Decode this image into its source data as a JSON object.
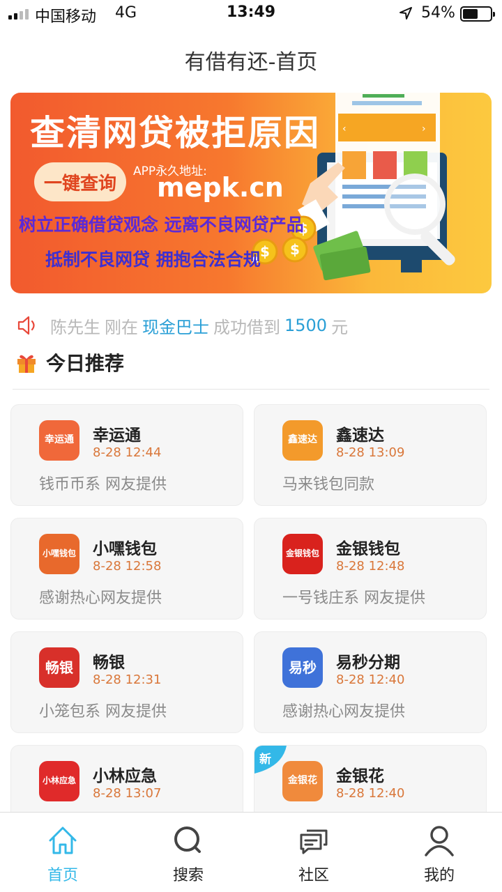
{
  "status_bar": {
    "carrier": "中国移动",
    "network": "4G",
    "time": "13:49",
    "battery_percent": "54%",
    "battery_level": 0.54
  },
  "header": {
    "title": "有借有还-首页"
  },
  "banner": {
    "headline": "查清网贷被拒原因",
    "button_label": "一键查询",
    "address_label": "APP永久地址:",
    "url": "mepk.cn",
    "line1": "树立正确借贷观念 远离不良网贷产品",
    "line2": "抵制不良网贷 拥抱合法合规"
  },
  "notice": {
    "name": "陈先生",
    "just": "刚在",
    "platform": "现金巴士",
    "success": "成功借到",
    "amount": "1500",
    "unit": "元"
  },
  "section": {
    "title": "今日推荐"
  },
  "cards": [
    {
      "name": "幸运通",
      "date": "8-28 12:44",
      "desc": "钱币币系 网友提供",
      "logo_text": "幸运通",
      "logo_color": "#f0683a",
      "is_new": false
    },
    {
      "name": "鑫速达",
      "date": "8-28 13:09",
      "desc": "马来钱包同款",
      "logo_text": "鑫速达",
      "logo_color": "#f39a2b",
      "is_new": false
    },
    {
      "name": "小嘿钱包",
      "date": "8-28 12:58",
      "desc": "感谢热心网友提供",
      "logo_text": "小嘿钱包",
      "logo_color": "#e8692c",
      "is_new": false
    },
    {
      "name": "金银钱包",
      "date": "8-28 12:48",
      "desc": "一号钱庄系 网友提供",
      "logo_text": "金银钱包",
      "logo_color": "#d9221d",
      "is_new": false
    },
    {
      "name": "畅银",
      "date": "8-28 12:31",
      "desc": "小笼包系 网友提供",
      "logo_text": "畅银",
      "logo_color": "#d8302a",
      "is_new": false
    },
    {
      "name": "易秒分期",
      "date": "8-28 12:40",
      "desc": "感谢热心网友提供",
      "logo_text": "易秒",
      "logo_sub": "易秒分期",
      "logo_color": "#3f72d9",
      "is_new": false
    },
    {
      "name": "小林应急",
      "date": "8-28 13:07",
      "desc": "",
      "logo_text": "小林应急",
      "logo_color": "#e02a2a",
      "is_new": false
    },
    {
      "name": "金银花",
      "date": "8-28 12:40",
      "desc": "",
      "logo_text": "金银花",
      "logo_color": "#f08a3c",
      "is_new": true,
      "new_label": "新"
    }
  ],
  "tabbar": {
    "items": [
      {
        "label": "首页",
        "icon": "home-icon",
        "active": true
      },
      {
        "label": "搜索",
        "icon": "search-icon",
        "active": false
      },
      {
        "label": "社区",
        "icon": "chat-icon",
        "active": false
      },
      {
        "label": "我的",
        "icon": "user-icon",
        "active": false
      }
    ],
    "active_color": "#33b8e8"
  }
}
